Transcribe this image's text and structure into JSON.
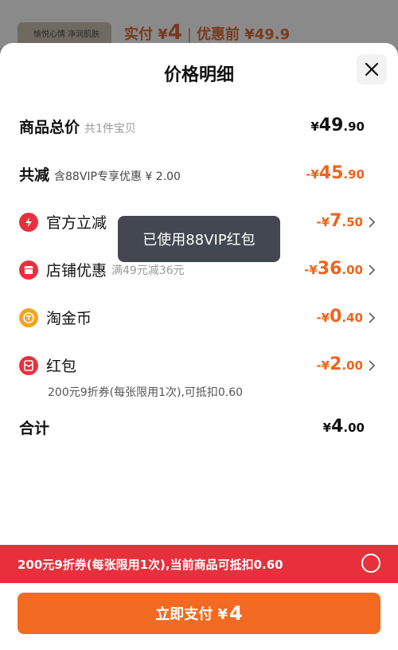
{
  "background": {
    "thumb_text": "愉悦心情 净润肌肤",
    "price_prefix": "实付 ¥",
    "price_value": "4",
    "separator": "|",
    "original_price": "优惠前 ¥49.9"
  },
  "sheet": {
    "title": "价格明细",
    "close_icon": "close-icon"
  },
  "rows": {
    "total": {
      "label": "商品总价",
      "sub": "共1件宝贝",
      "currency": "¥",
      "int": "49",
      "dec": ".90"
    },
    "reduction": {
      "label": "共减",
      "sub": "含88VIP专享优惠 ¥ 2.00",
      "currency": "-¥",
      "int": "45",
      "dec": ".90"
    },
    "official": {
      "label": "官方立减",
      "icon": "lightning-icon",
      "currency": "-¥",
      "int": "7",
      "dec": ".50"
    },
    "store": {
      "label": "店铺优惠",
      "sub": "满49元减36元",
      "icon": "store-icon",
      "currency": "-¥",
      "int": "36",
      "dec": ".00"
    },
    "coins": {
      "label": "淘金币",
      "icon": "coin-icon",
      "currency": "-¥",
      "int": "0",
      "dec": ".40"
    },
    "redpacket": {
      "label": "红包",
      "icon": "red-packet-icon",
      "currency": "-¥",
      "int": "2",
      "dec": ".00",
      "note": "200元9折券(每张限用1次),可抵扣0.60"
    },
    "sum": {
      "label": "合计",
      "currency": "¥",
      "int": "4",
      "dec": ".00"
    }
  },
  "toast": "已使用88VIP红包",
  "promo_bar": {
    "text": "200元9折券(每张限用1次),当前商品可抵扣0.60"
  },
  "pay_button": {
    "label": "立即支付 ¥",
    "amount": "4"
  },
  "colors": {
    "accent": "#f0631c",
    "promo": "#e8303d",
    "icon_red": "#e8303d",
    "coin": "#f3a521"
  }
}
